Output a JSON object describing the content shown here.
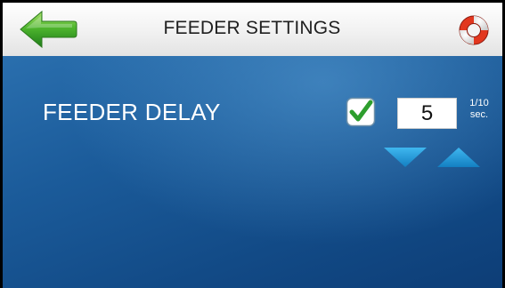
{
  "header": {
    "title": "FEEDER SETTINGS",
    "back_icon": "green-back-arrow-icon",
    "help_icon": "life-ring-icon"
  },
  "setting": {
    "label": "FEEDER DELAY",
    "enabled": true,
    "value": "5",
    "unit_line1": "1/10",
    "unit_line2": "sec."
  },
  "controls": {
    "decrease_icon": "triangle-down-icon",
    "increase_icon": "triangle-up-icon"
  },
  "colors": {
    "panel_blue": "#1b5b9a",
    "check_green": "#2e9e2e",
    "arrow_blue": "#1c9ad8"
  }
}
